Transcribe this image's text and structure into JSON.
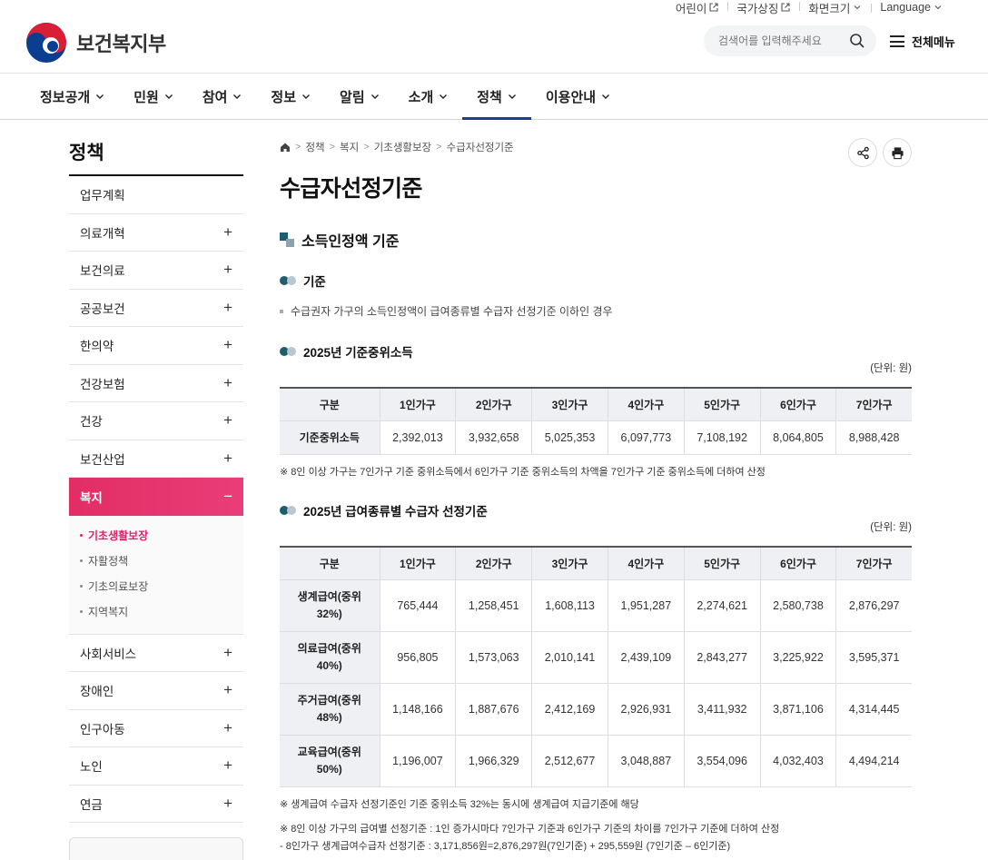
{
  "utility": [
    {
      "label": "어린이",
      "icon": "external-link-icon"
    },
    {
      "label": "국가상징",
      "icon": "external-link-icon"
    },
    {
      "label": "화면크기",
      "icon": "chevron-down-icon"
    },
    {
      "label": "Language",
      "icon": "chevron-down-icon"
    }
  ],
  "logo": {
    "name": "보건복지부"
  },
  "search": {
    "placeholder": "검색어를 입력해주세요"
  },
  "allmenu": {
    "label": "전체메뉴"
  },
  "gnb": [
    "정보공개",
    "민원",
    "참여",
    "정보",
    "알림",
    "소개",
    "정책",
    "이용안내"
  ],
  "gnb_active": "정책",
  "lnb": {
    "title": "정책",
    "items": [
      "업무계획",
      "의료개혁",
      "보건의료",
      "공공보건",
      "한의약",
      "건강보험",
      "건강",
      "보건산업"
    ],
    "open_item": "복지",
    "sub": [
      "기초생활보장",
      "자활정책",
      "기초의료보장",
      "지역복지"
    ],
    "after": [
      "사회서비스",
      "장애인",
      "인구아동",
      "노인",
      "연금"
    ],
    "plus": "+",
    "minus": "−"
  },
  "breadcrumb": [
    "정책",
    "복지",
    "기초생활보장",
    "수급자선정기준"
  ],
  "page_title": "수급자선정기준",
  "section": {
    "title": "소득인정액 기준",
    "criteria_title": "기준",
    "criteria_text": "수급권자 가구의 소득인정액이 급여종류별 수급자 선정기준 이하인 경우",
    "median_title": "2025년 기준중위소득",
    "unit": "(단위: 원)",
    "headers": [
      "구분",
      "1인가구",
      "2인가구",
      "3인가구",
      "4인가구",
      "5인가구",
      "6인가구",
      "7인가구"
    ],
    "median_row": {
      "label": "기준중위소득",
      "values": [
        "2,392,013",
        "3,932,658",
        "5,025,353",
        "6,097,773",
        "7,108,192",
        "8,064,805",
        "8,988,428"
      ]
    },
    "median_note": "※ 8인 이상 가구는 7인가구 기준 중위소득에서 6인가구 기준 중위소득의 차액을 7인가구 기준 중위소득에 더하여 산정",
    "selection_title": "2025년 급여종류별 수급자 선정기준",
    "selection_rows": [
      {
        "label": "생계급여(중위 32%)",
        "values": [
          "765,444",
          "1,258,451",
          "1,608,113",
          "1,951,287",
          "2,274,621",
          "2,580,738",
          "2,876,297"
        ]
      },
      {
        "label": "의료급여(중위 40%)",
        "values": [
          "956,805",
          "1,573,063",
          "2,010,141",
          "2,439,109",
          "2,843,277",
          "3,225,922",
          "3,595,371"
        ]
      },
      {
        "label": "주거급여(중위 48%)",
        "values": [
          "1,148,166",
          "1,887,676",
          "2,412,169",
          "2,926,931",
          "3,411,932",
          "3,871,106",
          "4,314,445"
        ]
      },
      {
        "label": "교육급여(중위 50%)",
        "values": [
          "1,196,007",
          "1,966,329",
          "2,512,677",
          "3,048,887",
          "3,554,096",
          "4,032,403",
          "4,494,214"
        ]
      }
    ],
    "notes": [
      "※ 생계급여 수급자 선정기준인 기준 중위소득 32%는 동시에 생계급여 지급기준에 해당",
      "※ 8인 이상 가구의 급여별 선정기준 : 1인 증가시마다 7인가구 기준과 6인가구 기준의 차이를 7인가구 기준에 더하여 산정",
      "- 8인가구 생계급여수급자 선정기준 : 3,171,856원=2,876,297원(7인기준) + 295,559원 (7인기준 – 6인기준)"
    ]
  },
  "colors": {
    "accent": "#1e3f8a",
    "lnb_active": "#e22d65",
    "teal": "#1d5e6e"
  }
}
